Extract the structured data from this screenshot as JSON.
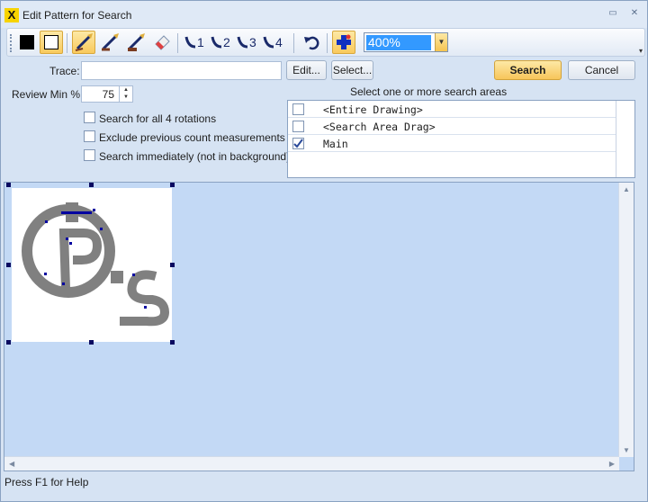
{
  "window": {
    "title": "Edit Pattern for Search",
    "app_icon": "X",
    "restore_glyph": "▭",
    "close_glyph": "✕"
  },
  "toolbar": {
    "buttons": [
      {
        "name": "fill-black-icon"
      },
      {
        "name": "fill-white-icon"
      },
      {
        "name": "draw-pencil-icon"
      },
      {
        "name": "draw-pencil-thin-icon"
      },
      {
        "name": "draw-pencil-thick-icon"
      },
      {
        "name": "eraser-icon"
      },
      {
        "name": "trace-1-icon"
      },
      {
        "name": "trace-2-icon"
      },
      {
        "name": "trace-3-icon"
      },
      {
        "name": "trace-4-icon"
      },
      {
        "name": "undo-icon"
      },
      {
        "name": "add-point-icon"
      }
    ],
    "zoom": {
      "value": "400%"
    }
  },
  "form": {
    "trace_label": "Trace:",
    "trace_value": "",
    "edit_button": "Edit...",
    "select_button": "Select...",
    "search_button": "Search",
    "cancel_button": "Cancel",
    "review_min_label": "Review Min %:",
    "review_min_value": "75",
    "search_areas_label": "Select one or more search areas",
    "options": [
      {
        "label": "Search for all 4 rotations",
        "checked": false
      },
      {
        "label": "Exclude previous count measurements",
        "checked": false
      },
      {
        "label": "Search immediately (not in background)",
        "checked": false
      }
    ]
  },
  "search_areas": [
    {
      "label": "<Entire Drawing>",
      "checked": false
    },
    {
      "label": "<Search Area Drag>",
      "checked": false
    },
    {
      "label": "Main",
      "checked": true
    }
  ],
  "status": {
    "text": "Press F1 for Help"
  },
  "colors": {
    "accent": "#f7c55a",
    "selection": "#3399ff",
    "canvas": "#c3d9f5",
    "pattern": "#808080",
    "vertex": "#0000a0"
  }
}
